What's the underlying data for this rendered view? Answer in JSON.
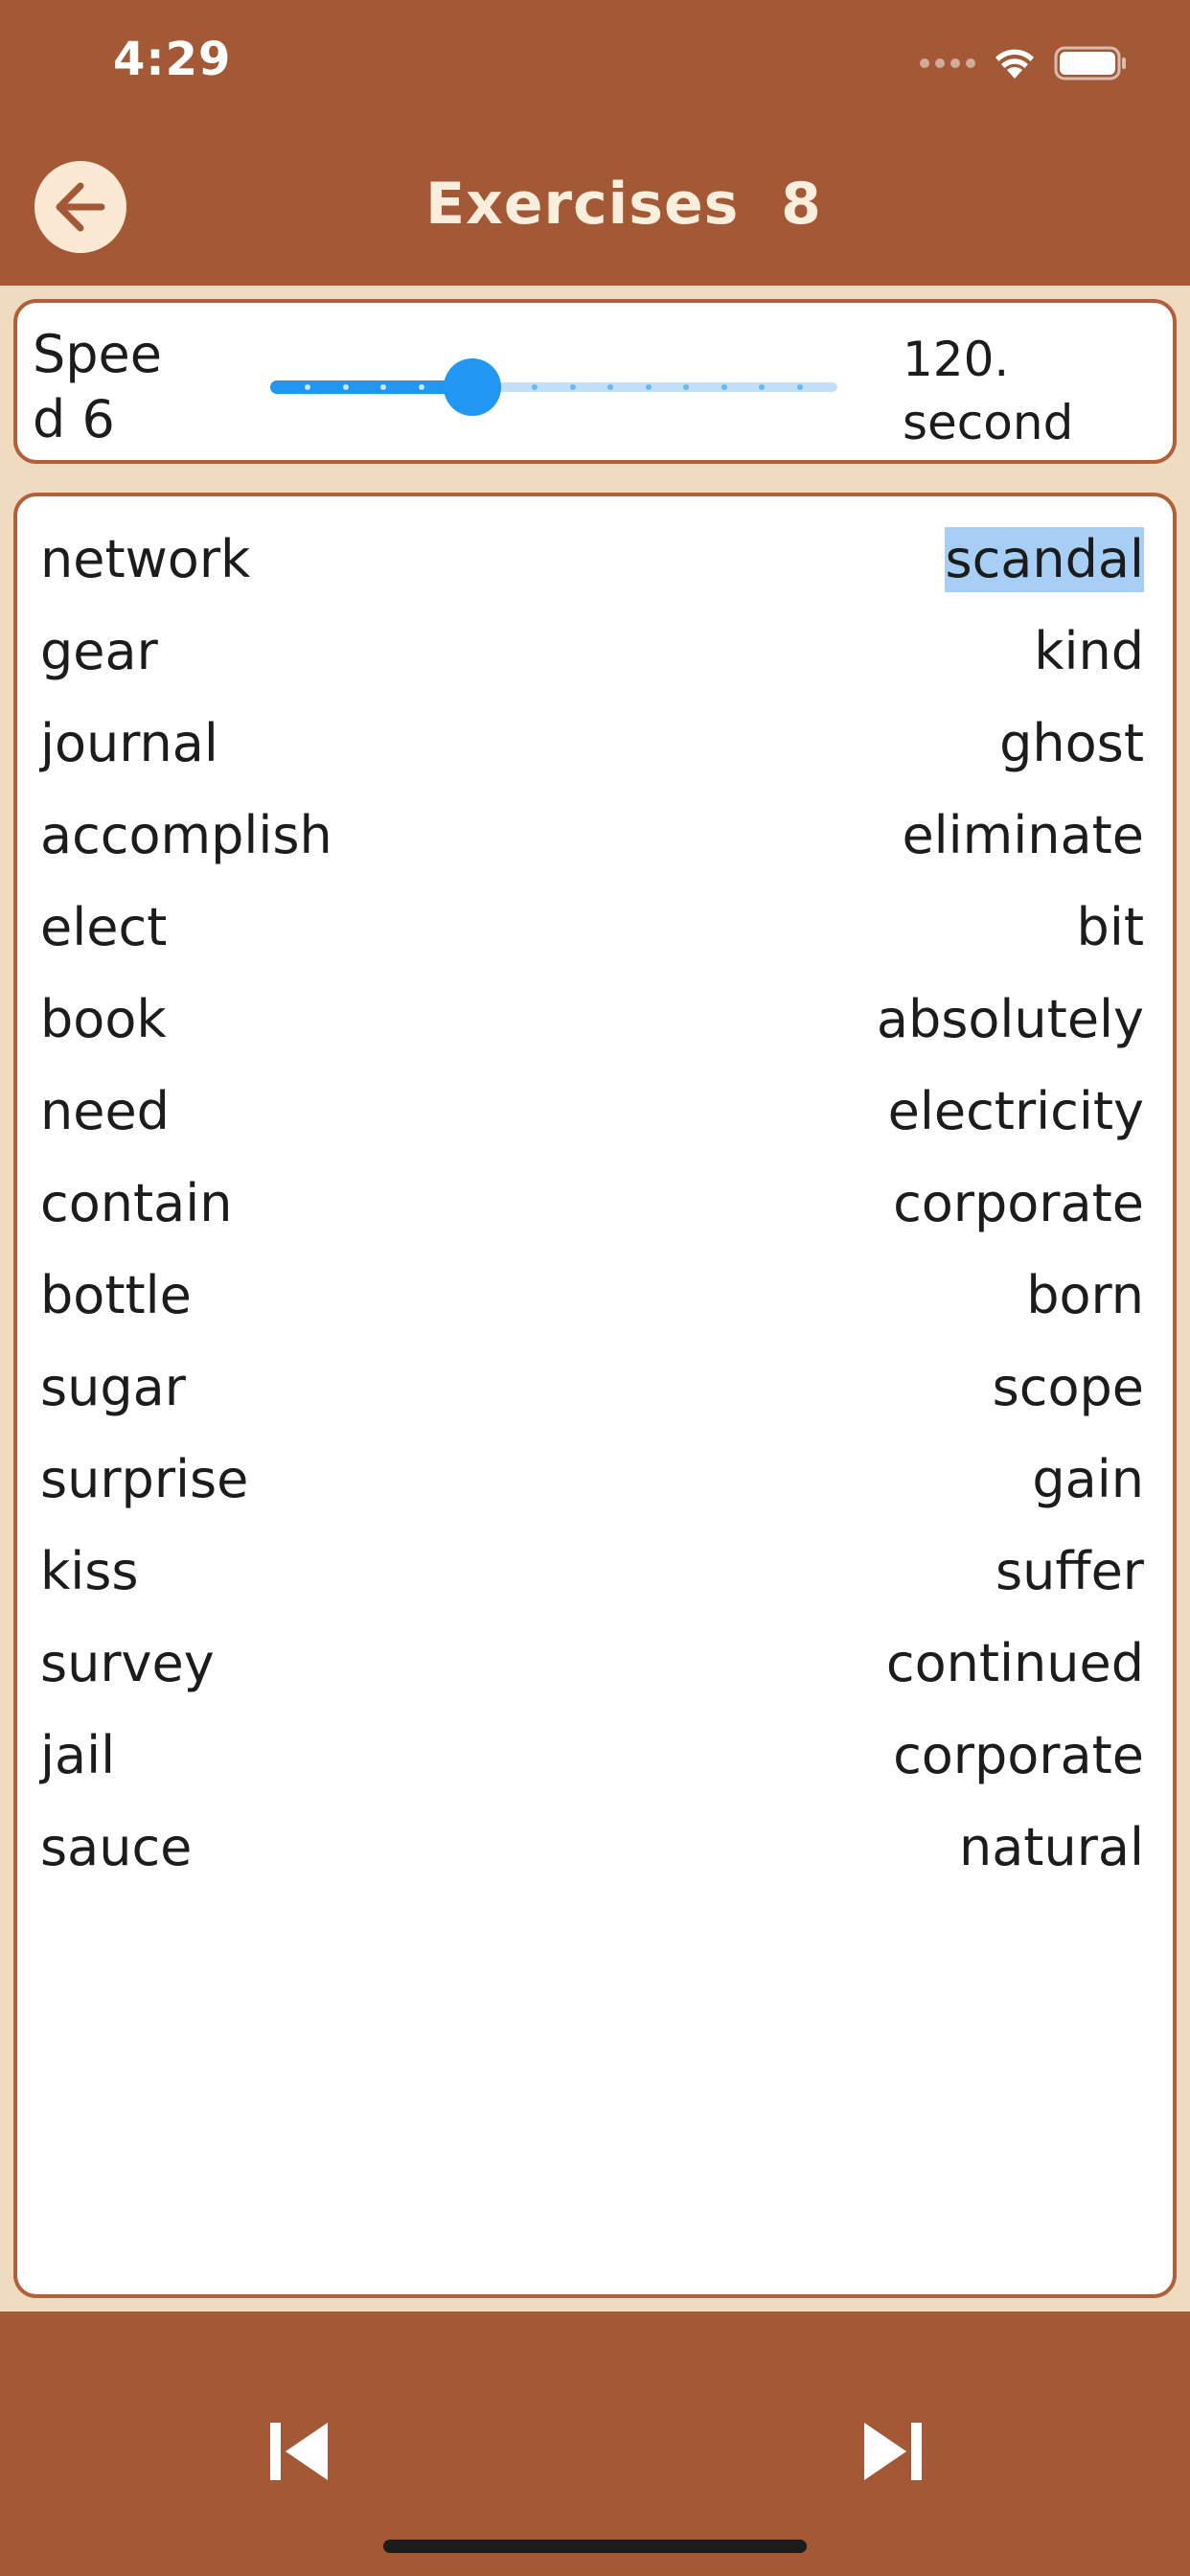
{
  "status_bar": {
    "time": "4:29"
  },
  "header": {
    "title": "Exercises  8"
  },
  "speed": {
    "label": "Speed 6",
    "value_text": "120. second",
    "slider_fraction": 0.357
  },
  "words": [
    {
      "left": "network",
      "right": "scandal"
    },
    {
      "left": "gear",
      "right": "kind"
    },
    {
      "left": "journal",
      "right": "ghost"
    },
    {
      "left": "accomplish",
      "right": "eliminate"
    },
    {
      "left": "elect",
      "right": "bit"
    },
    {
      "left": "book",
      "right": "absolutely"
    },
    {
      "left": "need",
      "right": "electricity"
    },
    {
      "left": "contain",
      "right": "corporate"
    },
    {
      "left": "bottle",
      "right": "born"
    },
    {
      "left": "sugar",
      "right": "scope"
    },
    {
      "left": "surprise",
      "right": "gain"
    },
    {
      "left": "kiss",
      "right": "suffer"
    },
    {
      "left": "survey",
      "right": "continued"
    },
    {
      "left": "jail",
      "right": "corporate"
    },
    {
      "left": "sauce",
      "right": "natural"
    }
  ],
  "selected_word": "scandal",
  "icons": {
    "back": "arrow-left-icon",
    "previous": "skip-previous-icon",
    "next": "skip-next-icon",
    "wifi": "wifi-icon",
    "battery": "battery-icon",
    "signal": "cellular-signal-icon"
  },
  "colors": {
    "bar": "#a35836",
    "background": "#efdcc0",
    "card_border": "#b0603b",
    "accent": "#2196f3",
    "selection": "#a7cff5"
  }
}
